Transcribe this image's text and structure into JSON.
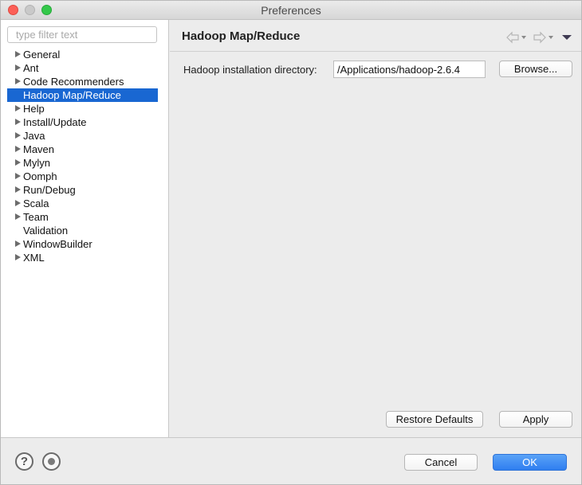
{
  "window": {
    "title": "Preferences"
  },
  "sidebar": {
    "filter_placeholder": "type filter text",
    "items": [
      {
        "label": "General",
        "expandable": true
      },
      {
        "label": "Ant",
        "expandable": true
      },
      {
        "label": "Code Recommenders",
        "expandable": true
      },
      {
        "label": "Hadoop Map/Reduce",
        "expandable": false,
        "selected": true
      },
      {
        "label": "Help",
        "expandable": true
      },
      {
        "label": "Install/Update",
        "expandable": true
      },
      {
        "label": "Java",
        "expandable": true
      },
      {
        "label": "Maven",
        "expandable": true
      },
      {
        "label": "Mylyn",
        "expandable": true
      },
      {
        "label": "Oomph",
        "expandable": true
      },
      {
        "label": "Run/Debug",
        "expandable": true
      },
      {
        "label": "Scala",
        "expandable": true
      },
      {
        "label": "Team",
        "expandable": true
      },
      {
        "label": "Validation",
        "expandable": false
      },
      {
        "label": "WindowBuilder",
        "expandable": true
      },
      {
        "label": "XML",
        "expandable": true
      }
    ]
  },
  "main": {
    "title": "Hadoop Map/Reduce",
    "nav_icons": [
      "back-arrow-icon",
      "forward-arrow-icon",
      "view-menu-icon"
    ],
    "install_dir_label": "Hadoop installation directory:",
    "install_dir_value": "/Applications/hadoop-2.6.4",
    "browse_label": "Browse...",
    "restore_defaults_label": "Restore Defaults",
    "apply_label": "Apply"
  },
  "footer": {
    "help_icon": "question-mark-icon",
    "record_icon": "record-macro-icon",
    "cancel_label": "Cancel",
    "ok_label": "OK"
  },
  "colors": {
    "selection": "#1967d2",
    "ok_button": "#2f7ef0"
  }
}
